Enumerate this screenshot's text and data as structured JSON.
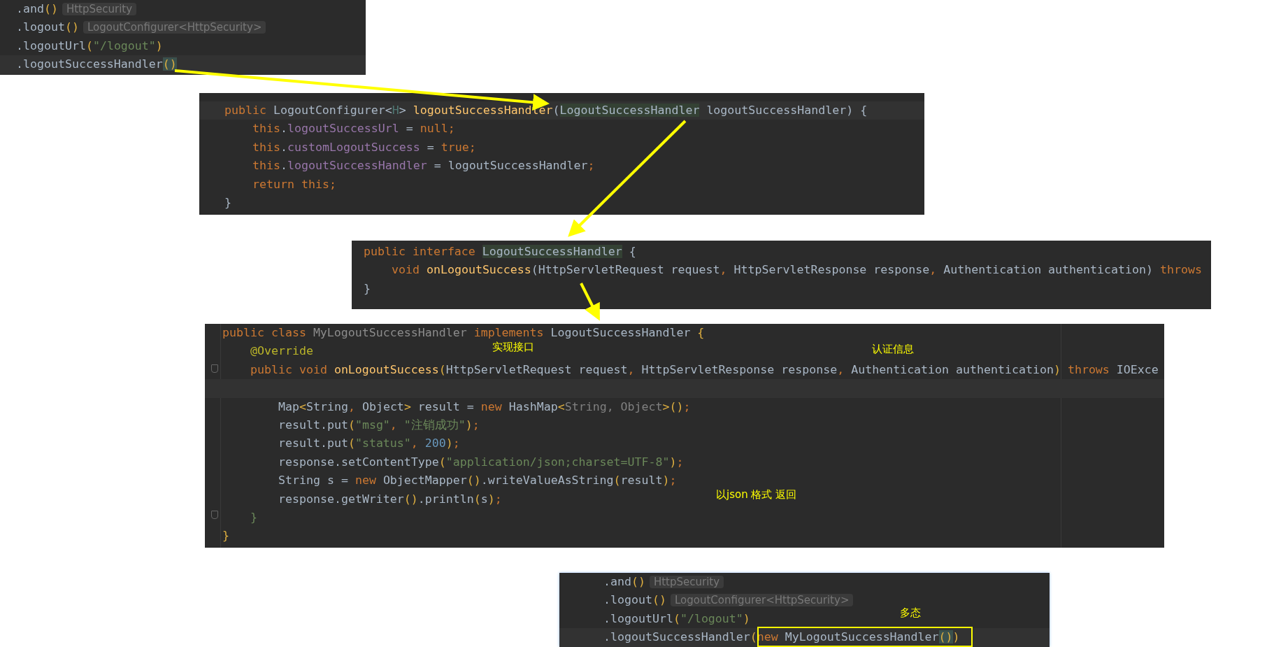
{
  "panels": [
    {
      "lines": [
        {
          "current": false,
          "tokens": [
            {
              "kind": "plain",
              "text": ".and"
            },
            {
              "kind": "paren",
              "text": "()"
            },
            {
              "kind": "hint",
              "text": "HttpSecurity"
            }
          ]
        },
        {
          "current": false,
          "tokens": [
            {
              "kind": "plain",
              "text": ".logout"
            },
            {
              "kind": "paren",
              "text": "()"
            },
            {
              "kind": "hint",
              "text": "LogoutConfigurer<HttpSecurity>"
            }
          ]
        },
        {
          "current": false,
          "tokens": [
            {
              "kind": "plain",
              "text": ".logoutUrl"
            },
            {
              "kind": "paren",
              "text": "("
            },
            {
              "kind": "string",
              "text": "\"/logout\""
            },
            {
              "kind": "paren",
              "text": ")"
            }
          ]
        },
        {
          "current": true,
          "tokens": [
            {
              "kind": "plain",
              "text": ".logoutSuccessHandler"
            },
            {
              "kind": "matched",
              "text": "()"
            }
          ]
        }
      ]
    },
    {
      "lines": [
        {
          "current": true,
          "tokens": [
            {
              "kind": "keyword",
              "text": "public "
            },
            {
              "kind": "plain",
              "text": "LogoutConfigurer<"
            },
            {
              "kind": "typeparam",
              "text": "H"
            },
            {
              "kind": "plain",
              "text": "> "
            },
            {
              "kind": "method",
              "text": "logoutSuccessHandler"
            },
            {
              "kind": "plain",
              "text": "("
            },
            {
              "kind": "highlight",
              "text": "LogoutSuccessHandler"
            },
            {
              "kind": "plain",
              "text": " logoutSuccessHandler) {"
            }
          ],
          "children": [
            {
              "current": false,
              "tokens": [
                {
                  "kind": "keyword",
                  "text": "this"
                },
                {
                  "kind": "plain",
                  "text": "."
                },
                {
                  "kind": "field",
                  "text": "logoutSuccessUrl"
                },
                {
                  "kind": "plain",
                  "text": " = "
                },
                {
                  "kind": "keyword",
                  "text": "null;"
                }
              ]
            },
            {
              "current": false,
              "tokens": [
                {
                  "kind": "keyword",
                  "text": "this"
                },
                {
                  "kind": "plain",
                  "text": "."
                },
                {
                  "kind": "field",
                  "text": "customLogoutSuccess"
                },
                {
                  "kind": "plain",
                  "text": " = "
                },
                {
                  "kind": "keyword",
                  "text": "true;"
                }
              ]
            },
            {
              "current": false,
              "tokens": [
                {
                  "kind": "keyword",
                  "text": "this"
                },
                {
                  "kind": "plain",
                  "text": "."
                },
                {
                  "kind": "field",
                  "text": "logoutSuccessHandler"
                },
                {
                  "kind": "plain",
                  "text": " = logoutSuccessHandler"
                },
                {
                  "kind": "keyword",
                  "text": ";"
                }
              ]
            },
            {
              "current": false,
              "tokens": [
                {
                  "kind": "keyword",
                  "text": "return this;"
                }
              ]
            }
          ]
        },
        {
          "current": false,
          "tokens": [
            {
              "kind": "plain",
              "text": "}"
            }
          ]
        }
      ]
    },
    {
      "lines": [
        {
          "current": false,
          "tokens": [
            {
              "kind": "keyword",
              "text": "public interface "
            },
            {
              "kind": "highlight",
              "text": "LogoutSuccessHandler"
            },
            {
              "kind": "plain",
              "text": " {"
            }
          ],
          "children": [
            {
              "current": false,
              "tokens": [
                {
                  "kind": "keyword",
                  "text": "void "
                },
                {
                  "kind": "method",
                  "text": "onLogoutSuccess"
                },
                {
                  "kind": "plain",
                  "text": "(HttpServletRequest request"
                },
                {
                  "kind": "keyword",
                  "text": ", "
                },
                {
                  "kind": "plain",
                  "text": "HttpServletResponse response"
                },
                {
                  "kind": "keyword",
                  "text": ", "
                },
                {
                  "kind": "plain",
                  "text": "Authentication authentication) "
                },
                {
                  "kind": "keyword",
                  "text": "throws"
                }
              ]
            }
          ]
        },
        {
          "current": false,
          "tokens": [
            {
              "kind": "plain",
              "text": "}"
            }
          ]
        }
      ]
    },
    {
      "lines": [
        {
          "current": false,
          "tokens": [
            {
              "kind": "keyword",
              "text": "public class "
            },
            {
              "kind": "unused",
              "text": "MyLogoutSuccessHandler "
            },
            {
              "kind": "keyword",
              "text": "implements "
            },
            {
              "kind": "plain",
              "text": "LogoutSuccessHandler "
            },
            {
              "kind": "paren",
              "text": "{"
            }
          ],
          "children": [
            {
              "current": false,
              "tokens": [
                {
                  "kind": "annotation",
                  "text": "@Override"
                }
              ]
            },
            {
              "current": false,
              "tokens": [
                {
                  "kind": "keyword",
                  "text": "public void "
                },
                {
                  "kind": "method",
                  "text": "onLogoutSuccess"
                },
                {
                  "kind": "paren",
                  "text": "("
                },
                {
                  "kind": "plain",
                  "text": "HttpServletRequest request"
                },
                {
                  "kind": "keyword",
                  "text": ", "
                },
                {
                  "kind": "plain",
                  "text": "HttpServletResponse response"
                },
                {
                  "kind": "keyword",
                  "text": ", "
                },
                {
                  "kind": "plain",
                  "text": "Authentication authentication"
                },
                {
                  "kind": "paren",
                  "text": ")"
                },
                {
                  "kind": "keyword",
                  "text": " throws "
                },
                {
                  "kind": "plain",
                  "text": "IOExce"
                }
              ],
              "children": [
                {
                  "current": true
                },
                {
                  "current": false,
                  "tokens": [
                    {
                      "kind": "plain",
                      "text": "Map"
                    },
                    {
                      "kind": "paren",
                      "text": "<"
                    },
                    {
                      "kind": "plain",
                      "text": "String"
                    },
                    {
                      "kind": "keyword",
                      "text": ", "
                    },
                    {
                      "kind": "plain",
                      "text": "Object"
                    },
                    {
                      "kind": "paren",
                      "text": ">"
                    },
                    {
                      "kind": "plain",
                      "text": " result = "
                    },
                    {
                      "kind": "keyword",
                      "text": "new "
                    },
                    {
                      "kind": "plain",
                      "text": "HashMap"
                    },
                    {
                      "kind": "paren",
                      "text": "<"
                    },
                    {
                      "kind": "generic",
                      "text": "String, Object"
                    },
                    {
                      "kind": "paren",
                      "text": ">()"
                    },
                    {
                      "kind": "keyword",
                      "text": ";"
                    }
                  ]
                },
                {
                  "current": false,
                  "tokens": [
                    {
                      "kind": "plain",
                      "text": "result.put"
                    },
                    {
                      "kind": "paren",
                      "text": "("
                    },
                    {
                      "kind": "string",
                      "text": "\"msg\""
                    },
                    {
                      "kind": "keyword",
                      "text": ", "
                    },
                    {
                      "kind": "string",
                      "text": "\"注销成功\""
                    },
                    {
                      "kind": "paren",
                      "text": ")"
                    },
                    {
                      "kind": "keyword",
                      "text": ";"
                    }
                  ]
                },
                {
                  "current": false,
                  "tokens": [
                    {
                      "kind": "plain",
                      "text": "result.put"
                    },
                    {
                      "kind": "paren",
                      "text": "("
                    },
                    {
                      "kind": "string",
                      "text": "\"status\""
                    },
                    {
                      "kind": "keyword",
                      "text": ", "
                    },
                    {
                      "kind": "number",
                      "text": "200"
                    },
                    {
                      "kind": "paren",
                      "text": ")"
                    },
                    {
                      "kind": "keyword",
                      "text": ";"
                    }
                  ]
                },
                {
                  "current": false,
                  "tokens": [
                    {
                      "kind": "plain",
                      "text": "response.setContentType"
                    },
                    {
                      "kind": "paren",
                      "text": "("
                    },
                    {
                      "kind": "string",
                      "text": "\"application/json;charset=UTF-8\""
                    },
                    {
                      "kind": "paren",
                      "text": ")"
                    },
                    {
                      "kind": "keyword",
                      "text": ";"
                    }
                  ]
                },
                {
                  "current": false,
                  "tokens": [
                    {
                      "kind": "plain",
                      "text": "String s = "
                    },
                    {
                      "kind": "keyword",
                      "text": "new "
                    },
                    {
                      "kind": "plain",
                      "text": "ObjectMapper"
                    },
                    {
                      "kind": "paren",
                      "text": "()"
                    },
                    {
                      "kind": "plain",
                      "text": ".writeValueAsString"
                    },
                    {
                      "kind": "paren",
                      "text": "("
                    },
                    {
                      "kind": "plain",
                      "text": "result"
                    },
                    {
                      "kind": "paren",
                      "text": ")"
                    },
                    {
                      "kind": "keyword",
                      "text": ";"
                    }
                  ]
                },
                {
                  "current": false,
                  "tokens": [
                    {
                      "kind": "plain",
                      "text": "response.getWriter"
                    },
                    {
                      "kind": "paren",
                      "text": "()"
                    },
                    {
                      "kind": "plain",
                      "text": ".println"
                    },
                    {
                      "kind": "paren",
                      "text": "("
                    },
                    {
                      "kind": "plain",
                      "text": "s"
                    },
                    {
                      "kind": "paren",
                      "text": ")"
                    },
                    {
                      "kind": "keyword",
                      "text": ";"
                    }
                  ]
                }
              ]
            },
            {
              "current": false,
              "tokens": [
                {
                  "kind": "greenbrace",
                  "text": "}"
                }
              ]
            }
          ]
        },
        {
          "current": false,
          "tokens": [
            {
              "kind": "paren",
              "text": "}"
            }
          ]
        }
      ]
    },
    {
      "lines": [
        {
          "current": false,
          "tokens": [
            {
              "kind": "plain",
              "text": ".and"
            },
            {
              "kind": "paren",
              "text": "()"
            },
            {
              "kind": "hint",
              "text": "HttpSecurity"
            }
          ]
        },
        {
          "current": false,
          "tokens": [
            {
              "kind": "plain",
              "text": ".logout"
            },
            {
              "kind": "paren",
              "text": "()"
            },
            {
              "kind": "hint",
              "text": "LogoutConfigurer<HttpSecurity>"
            }
          ]
        },
        {
          "current": false,
          "tokens": [
            {
              "kind": "plain",
              "text": ".logoutUrl"
            },
            {
              "kind": "paren",
              "text": "("
            },
            {
              "kind": "string",
              "text": "\"/logout\""
            },
            {
              "kind": "paren",
              "text": ")"
            }
          ]
        },
        {
          "current": true,
          "tokens": [
            {
              "kind": "plain",
              "text": ".logoutSuccessHandler"
            },
            {
              "kind": "paren",
              "text": "("
            },
            {
              "kind": "keyword",
              "text": "new "
            },
            {
              "kind": "plain",
              "text": "MyLogoutSuccessHandler"
            },
            {
              "kind": "matched",
              "text": "()"
            },
            {
              "kind": "paren",
              "text": ")"
            }
          ]
        }
      ]
    }
  ],
  "notes": [
    {
      "text": "实现接口"
    },
    {
      "text": "认证信息"
    },
    {
      "text": "以json 格式 返回"
    },
    {
      "text": "多态"
    }
  ]
}
